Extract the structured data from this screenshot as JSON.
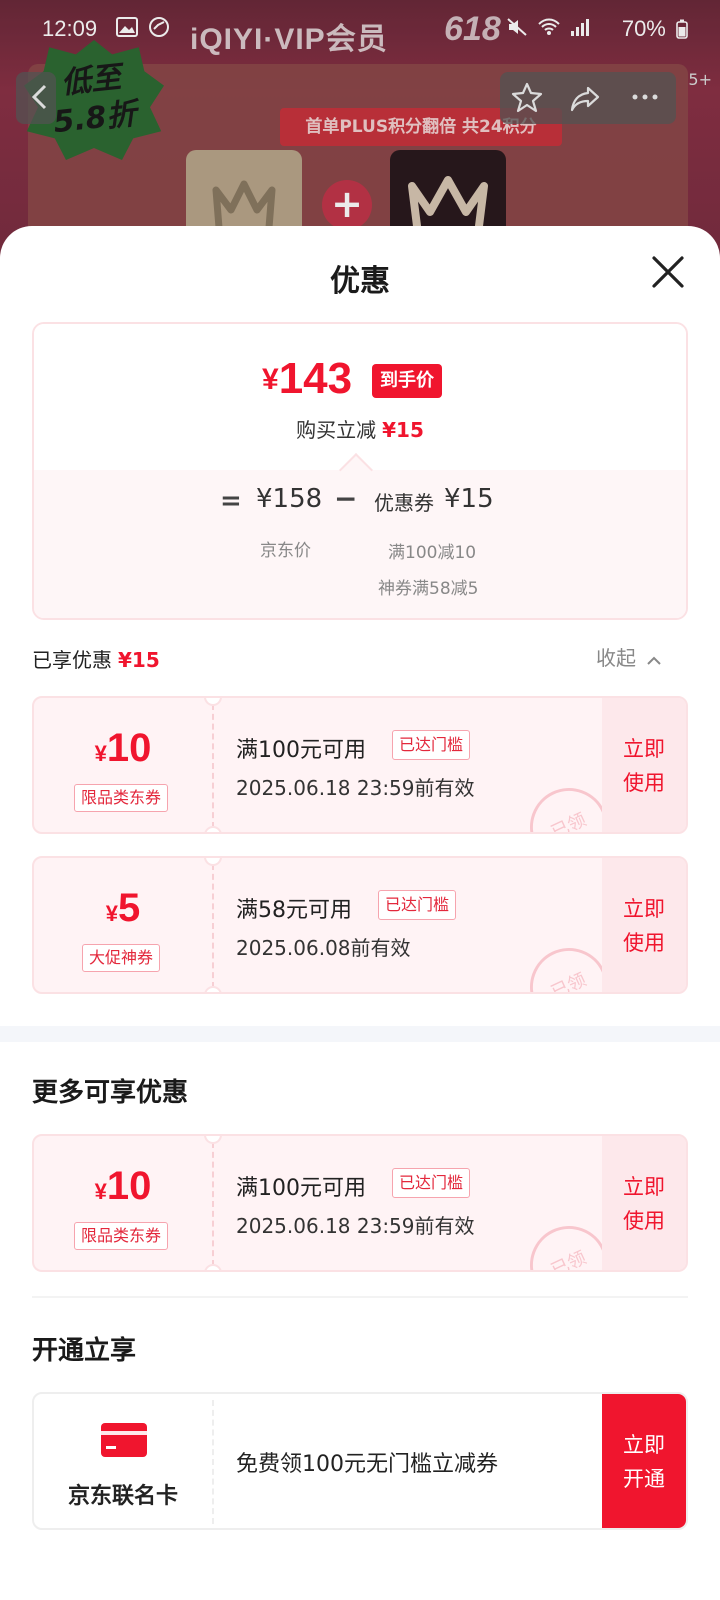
{
  "status_bar": {
    "time": "12:09",
    "battery": "70%"
  },
  "background_page": {
    "banner_title": "iQIYI·VIP会员",
    "banner_618": "618",
    "promo_strip": "首单PLUS积分翻倍 共24积分",
    "discount_badge": "低至5.8折",
    "notification_count": "5+"
  },
  "sheet": {
    "title": "优惠",
    "summary": {
      "currency": "¥",
      "final_price": "143",
      "final_price_tag": "到手价",
      "save_label": "购买立减",
      "save_value": "¥15",
      "equals": "=",
      "base_price": "¥158",
      "base_label": "京东价",
      "minus": "−",
      "coupon_label": "优惠券",
      "coupon_value": "¥15",
      "coupon_detail_1": "满100减10",
      "coupon_detail_2": "神券满58减5"
    },
    "enjoyed": {
      "label": "已享优惠",
      "value": "¥15",
      "collapse_label": "收起"
    },
    "enjoyed_coupons": [
      {
        "currency": "¥",
        "amount": "10",
        "type": "限品类东券",
        "condition": "满100元可用",
        "flag": "已达门槛",
        "validity": "2025.06.18 23:59前有效",
        "action": "立即使用",
        "stamp": "已领"
      },
      {
        "currency": "¥",
        "amount": "5",
        "type": "大促神券",
        "condition": "满58元可用",
        "flag": "已达门槛",
        "validity": "2025.06.08前有效",
        "action": "立即使用",
        "stamp": "已领"
      }
    ],
    "more_title": "更多可享优惠",
    "more_coupons": [
      {
        "currency": "¥",
        "amount": "10",
        "type": "限品类东券",
        "condition": "满100元可用",
        "flag": "已达门槛",
        "validity": "2025.06.18 23:59前有效",
        "action": "立即使用",
        "stamp": "已领"
      }
    ],
    "open_title": "开通立享",
    "card_offer": {
      "name": "京东联名卡",
      "description": "免费领100元无门槛立减券",
      "action": "立即开通"
    }
  },
  "colors": {
    "accent_red": "#f0152e",
    "coupon_bg": "#fff3f5",
    "coupon_border": "#fbe1e4"
  }
}
